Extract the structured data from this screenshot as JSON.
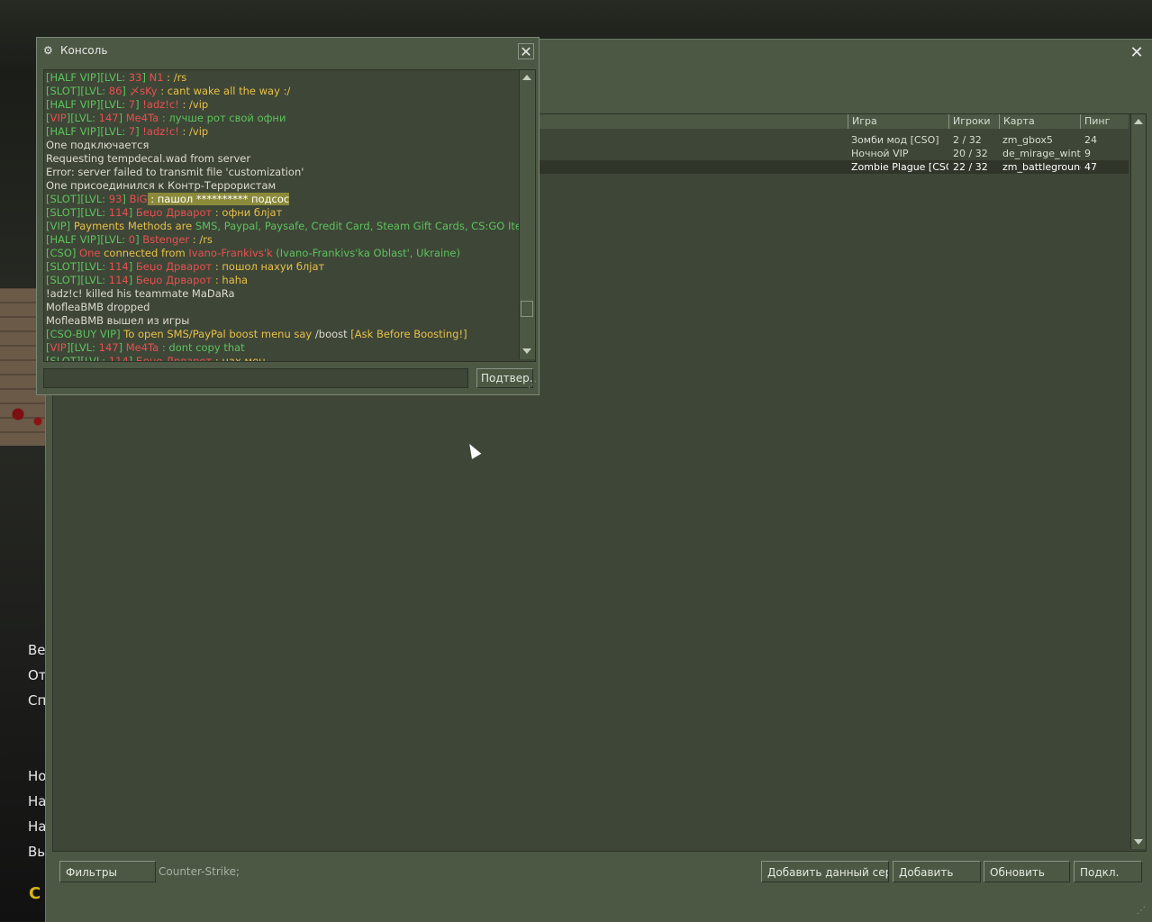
{
  "background_menu": {
    "items": [
      "Ве",
      "От",
      "Сп",
      "Но",
      "На",
      "На",
      "Вы"
    ],
    "logo": "C"
  },
  "browser": {
    "columns": [
      "Игра",
      "Игроки",
      "Карта",
      "Пинг"
    ],
    "servers": [
      {
        "game": "Зомби мод [CSO]",
        "players": "2 / 32",
        "map": "zm_gbox5",
        "ping": "24",
        "selected": false
      },
      {
        "game": "Ночной VIP",
        "players": "20 / 32",
        "map": "de_mirage_winter",
        "ping": "9",
        "selected": false
      },
      {
        "game": "Zombie Plague [CSO]",
        "players": "22 / 32",
        "map": "zm_battleground…",
        "ping": "47",
        "selected": true
      }
    ],
    "filters_button": "Фильтры",
    "filter_info": "Counter-Strike;",
    "add_current_button": "Добавить данный серве",
    "add_button": "Добавить",
    "refresh_button": "Обновить",
    "connect_button": "Подкл."
  },
  "console": {
    "title": "Консоль",
    "submit_button": "Подтвер...",
    "input_value": "",
    "lines": [
      [
        [
          "g",
          "[HALF VIP][LVL: "
        ],
        [
          "r",
          "33"
        ],
        [
          "g",
          "] "
        ],
        [
          "r",
          "N1"
        ],
        [
          "y",
          " : /rs"
        ]
      ],
      [
        [
          "g",
          "[SLOT][LVL: "
        ],
        [
          "r",
          "86"
        ],
        [
          "g",
          "] "
        ],
        [
          "r",
          "〆sKy"
        ],
        [
          "y",
          " : cant wake all the way :/"
        ]
      ],
      [
        [
          "g",
          "[HALF VIP][LVL: "
        ],
        [
          "r",
          "7"
        ],
        [
          "g",
          "] "
        ],
        [
          "r",
          "!adz!c!"
        ],
        [
          "y",
          " : /vip"
        ]
      ],
      [
        [
          "g",
          "["
        ],
        [
          "r",
          "VIP"
        ],
        [
          "g",
          "][LVL: "
        ],
        [
          "r",
          "147"
        ],
        [
          "g",
          "] "
        ],
        [
          "r",
          "Me4Ta"
        ],
        [
          "g",
          " : лучше рот свой офни"
        ]
      ],
      [
        [
          "g",
          "[HALF VIP][LVL: "
        ],
        [
          "r",
          "7"
        ],
        [
          "g",
          "] "
        ],
        [
          "r",
          "!adz!c!"
        ],
        [
          "y",
          " : /vip"
        ]
      ],
      [
        [
          "w",
          "One подключается"
        ]
      ],
      [
        [
          "w",
          "Requesting tempdecal.wad from server"
        ]
      ],
      [
        [
          "w",
          "Error: server failed to transmit file 'customization'"
        ]
      ],
      [
        [
          "w",
          "One присоединился к Контр-Террористам"
        ]
      ],
      [
        [
          "g",
          "[SLOT][LVL: "
        ],
        [
          "r",
          "93"
        ],
        [
          "g",
          "] "
        ],
        [
          "r",
          "BiG"
        ],
        [
          "hl",
          " : пашол ********** подсос"
        ]
      ],
      [
        [
          "g",
          "[SLOT][LVL: "
        ],
        [
          "r",
          "114"
        ],
        [
          "g",
          "] "
        ],
        [
          "r",
          "Беџо Дрварот"
        ],
        [
          "y",
          " : офни блјат"
        ]
      ],
      [
        [
          "g",
          "[VIP] "
        ],
        [
          "y",
          "Payments Methods are "
        ],
        [
          "g",
          "SMS, Paypal, Paysafe, Credit Card, Steam Gift Cards, CS:GO Items"
        ]
      ],
      [
        [
          "g",
          "[HALF VIP][LVL: "
        ],
        [
          "r",
          "0"
        ],
        [
          "g",
          "] "
        ],
        [
          "r",
          "Bstenger"
        ],
        [
          "y",
          " : /rs"
        ]
      ],
      [
        [
          "g",
          "[CSO] "
        ],
        [
          "r",
          "One"
        ],
        [
          "y",
          " connected from "
        ],
        [
          "r",
          "Ivano-Frankivs'k"
        ],
        [
          "g",
          " (Ivano-Frankivs'ka Oblast', Ukraine)"
        ]
      ],
      [
        [
          "g",
          "[SLOT][LVL: "
        ],
        [
          "r",
          "114"
        ],
        [
          "g",
          "] "
        ],
        [
          "r",
          "Беџо Дрварот"
        ],
        [
          "y",
          " : пошол нахуи блјат"
        ]
      ],
      [
        [
          "g",
          "[SLOT][LVL: "
        ],
        [
          "r",
          "114"
        ],
        [
          "g",
          "] "
        ],
        [
          "r",
          "Беџо Дрварот"
        ],
        [
          "y",
          " : haha"
        ]
      ],
      [
        [
          "w",
          "!adz!c! killed his teammate MaDaRa"
        ]
      ],
      [
        [
          "w",
          "MofleaBMB dropped"
        ]
      ],
      [
        [
          "w",
          "MofleaBMB вышел из игры"
        ]
      ],
      [
        [
          "g",
          "[CSO-BUY VIP] "
        ],
        [
          "y",
          "To open SMS/PayPal boost menu say "
        ],
        [
          "w",
          "/boost "
        ],
        [
          "y",
          "[Ask Before Boosting!]"
        ]
      ],
      [
        [
          "g",
          "["
        ],
        [
          "r",
          "VIP"
        ],
        [
          "g",
          "][LVL: "
        ],
        [
          "r",
          "147"
        ],
        [
          "g",
          "] "
        ],
        [
          "r",
          "Me4Ta"
        ],
        [
          "g",
          " : dont copy that"
        ]
      ],
      [
        [
          "g",
          "[SLOT][LVL: "
        ],
        [
          "r",
          "114"
        ],
        [
          "g",
          "] "
        ],
        [
          "r",
          "Беџо Дрварот"
        ],
        [
          "y",
          " : нах мен"
        ]
      ]
    ]
  }
}
